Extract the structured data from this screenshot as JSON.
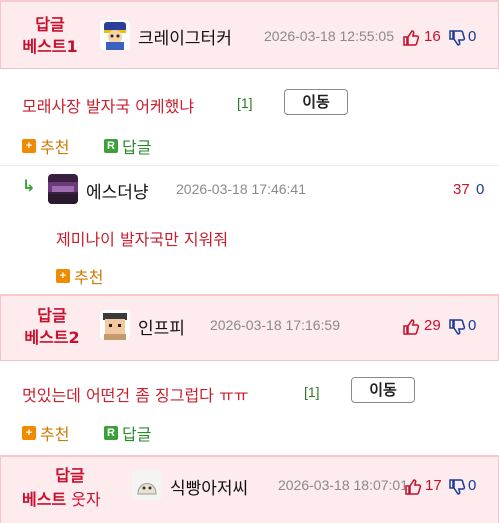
{
  "best1": {
    "label_line1": "답글",
    "label_line2": "베스트1",
    "nick": "크레이그터커",
    "date": "2026-03-18 12:55:05",
    "up": "16",
    "down": "0",
    "comment": "모래사장 발자국 어케했냐",
    "ref": "[1]",
    "move_label": "이동",
    "recommend_label": "추천",
    "reply_label": "답글"
  },
  "reply1": {
    "arrow": "↳",
    "nick": "에스더냥",
    "date": "2026-03-18 17:46:41",
    "up": "37",
    "down": "0",
    "comment": "제미나이 발자국만 지워줘",
    "recommend_label": "추천"
  },
  "best2": {
    "label_line1": "답글",
    "label_line2": "베스트2",
    "nick": "인프피",
    "date": "2026-03-18 17:16:59",
    "up": "29",
    "down": "0",
    "comment": "멋있는데 어떤건 좀 징그럽다 ㅠㅠ",
    "ref": "[1]",
    "move_label": "이동",
    "recommend_label": "추천",
    "reply_label": "답글"
  },
  "best3": {
    "label_line1": "답글",
    "label_line2": "베스트",
    "label_sub": "웃자",
    "nick": "식빵아저씨",
    "date": "2026-03-18 18:07:01",
    "up": "17",
    "down": "0"
  },
  "icons": {
    "recommend_box": "+",
    "reply_box": "R",
    "thumb_up": "thumbs-up-icon",
    "thumb_down": "thumbs-down-icon"
  },
  "colors": {
    "best_bg": "#fdebed",
    "best_label": "#c8102e",
    "up_count": "#c8102e",
    "down_count": "#1a3a9a",
    "comment_text": "#c8202e",
    "recommend": "#d07a00",
    "reply": "#2a8a2a"
  }
}
